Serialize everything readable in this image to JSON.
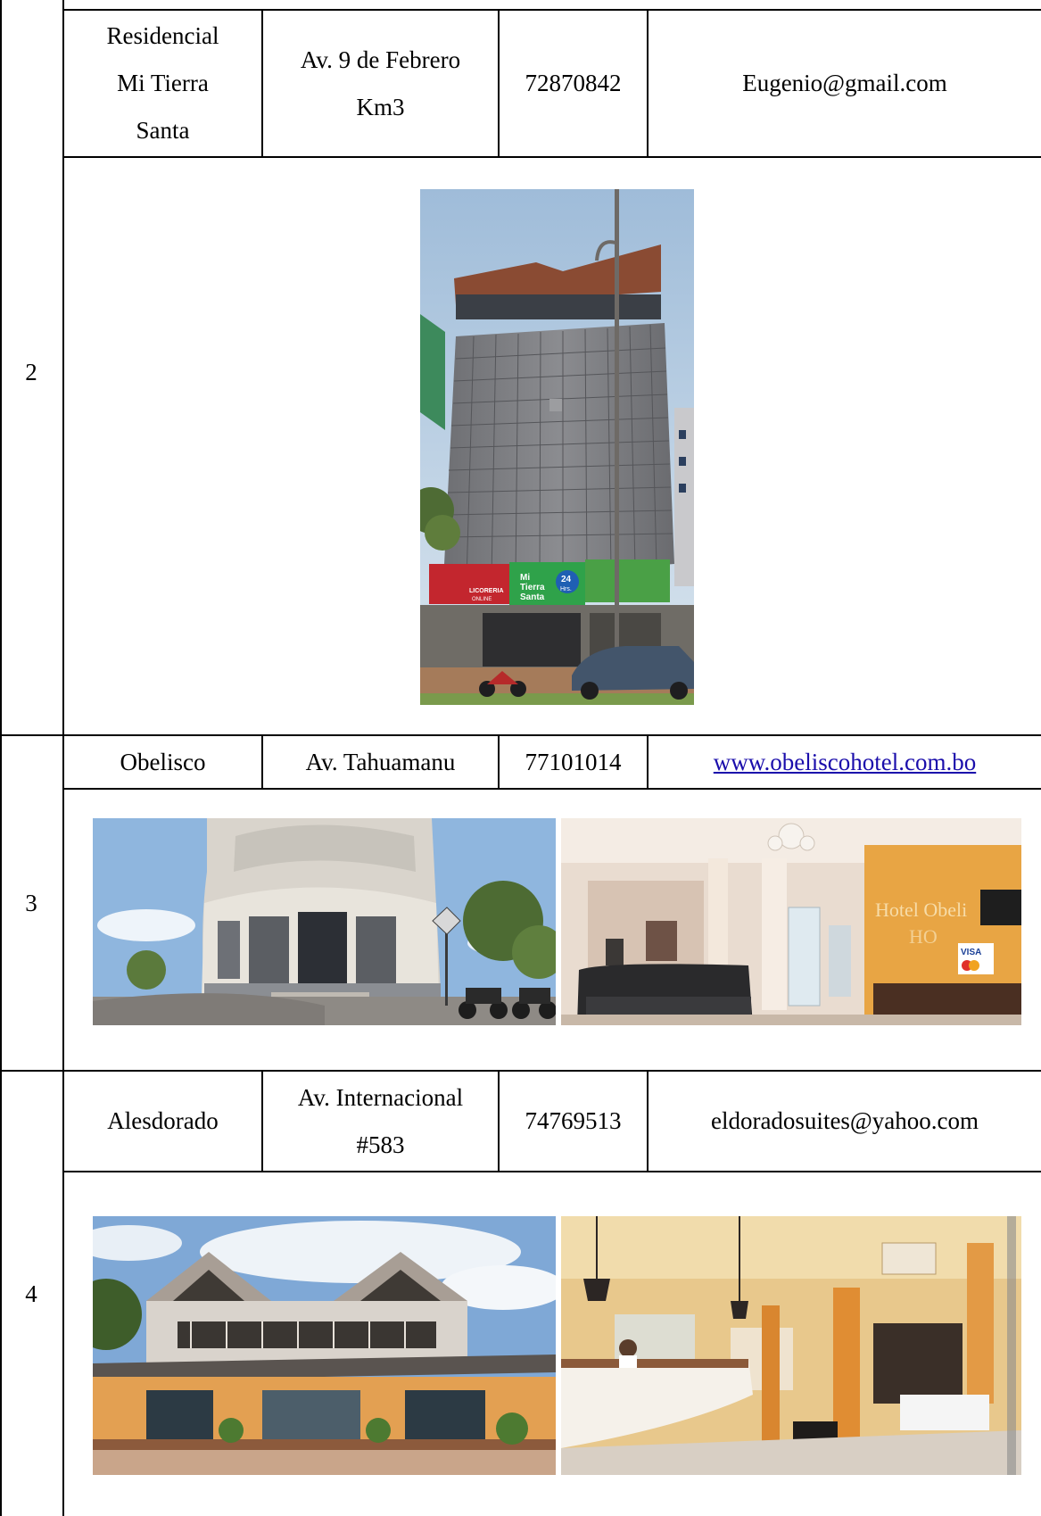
{
  "rows": [
    {
      "number": "2",
      "name": "Residencial Mi Tierra Santa",
      "name_lines": [
        "Residencial",
        "Mi Tierra",
        "Santa"
      ],
      "address_lines": [
        "Av. 9 de Febrero",
        "Km3"
      ],
      "phone": "72870842",
      "contact": "Eugenio@gmail.com",
      "contact_is_link": false,
      "photos": [
        {
          "alt": "Facade of Residencial Mi Tierra Santa",
          "icon": "building-photo"
        }
      ]
    },
    {
      "number": "3",
      "name_lines": [
        "Obelisco"
      ],
      "address_lines": [
        "Av. Tahuamanu"
      ],
      "phone": "77101014",
      "contact": "www.obeliscohotel.com.bo",
      "contact_is_link": true,
      "photos": [
        {
          "alt": "Exterior of Hotel Obelisco",
          "icon": "building-photo"
        },
        {
          "alt": "Lobby of Hotel Obelisco",
          "icon": "lobby-photo"
        }
      ]
    },
    {
      "number": "4",
      "name_lines": [
        "Alesdorado"
      ],
      "address_lines": [
        "Av. Internacional",
        "#583"
      ],
      "phone": "74769513",
      "contact": "eldoradosuites@yahoo.com",
      "contact_is_link": false,
      "photos": [
        {
          "alt": "Exterior of Alesdorado hotel",
          "icon": "building-photo"
        },
        {
          "alt": "Reception of Alesdorado hotel",
          "icon": "lobby-photo"
        }
      ]
    }
  ],
  "photo_signage": {
    "tierra_santa_sign": [
      "Mi",
      "Tierra",
      "Santa"
    ],
    "tierra_santa_hours": [
      "24",
      "Hrs."
    ],
    "licoreria": [
      "LICORERIA",
      "ONLINE"
    ],
    "obelisco_wall": "Hotel Obeli",
    "obelisco_logo": "HO",
    "visa": "VISA"
  },
  "colors": {
    "border": "#000000",
    "link": "#1a0dab"
  }
}
